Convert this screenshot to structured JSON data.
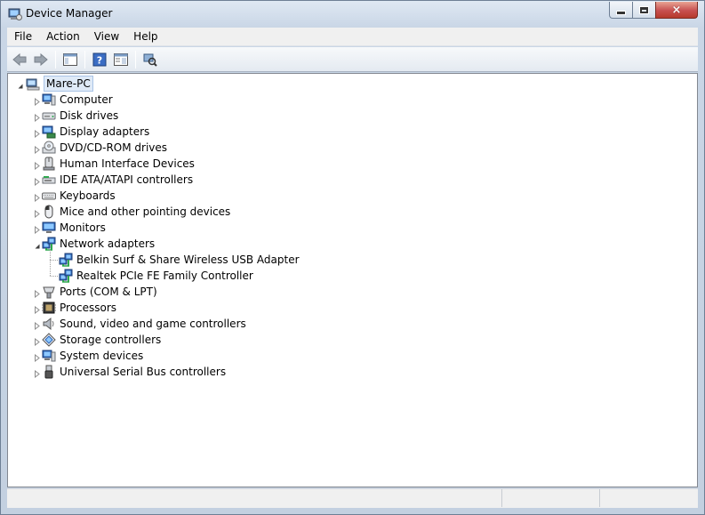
{
  "window": {
    "title": "Device Manager",
    "icon": "device-manager-icon",
    "controls": {
      "minimize": "minimize-icon",
      "maximize": "maximize-icon",
      "close": "×"
    }
  },
  "menu": [
    {
      "label": "File"
    },
    {
      "label": "Action"
    },
    {
      "label": "View"
    },
    {
      "label": "Help"
    }
  ],
  "toolbar": {
    "buttons": [
      "back-arrow-icon",
      "forward-arrow-icon",
      "show-hide-console-tree-icon",
      "help-icon",
      "properties-icon",
      "scan-hardware-icon"
    ]
  },
  "tree": {
    "root": {
      "label": "Mare-PC",
      "expanded": true,
      "icon": "computer-tree-root-icon"
    },
    "categories": [
      {
        "label": "Computer",
        "icon": "computer-icon",
        "expanded": false
      },
      {
        "label": "Disk drives",
        "icon": "disk-drive-icon",
        "expanded": false
      },
      {
        "label": "Display adapters",
        "icon": "display-adapter-icon",
        "expanded": false
      },
      {
        "label": "DVD/CD-ROM drives",
        "icon": "dvd-drive-icon",
        "expanded": false
      },
      {
        "label": "Human Interface Devices",
        "icon": "hid-icon",
        "expanded": false
      },
      {
        "label": "IDE ATA/ATAPI controllers",
        "icon": "ide-controller-icon",
        "expanded": false
      },
      {
        "label": "Keyboards",
        "icon": "keyboard-icon",
        "expanded": false
      },
      {
        "label": "Mice and other pointing devices",
        "icon": "mouse-icon",
        "expanded": false
      },
      {
        "label": "Monitors",
        "icon": "monitor-icon",
        "expanded": false
      },
      {
        "label": "Network adapters",
        "icon": "network-adapter-icon",
        "expanded": true,
        "children": [
          {
            "label": "Belkin Surf & Share Wireless USB Adapter",
            "icon": "network-adapter-icon"
          },
          {
            "label": "Realtek PCIe FE Family Controller",
            "icon": "network-adapter-icon"
          }
        ]
      },
      {
        "label": "Ports (COM & LPT)",
        "icon": "port-icon",
        "expanded": false
      },
      {
        "label": "Processors",
        "icon": "processor-icon",
        "expanded": false
      },
      {
        "label": "Sound, video and game controllers",
        "icon": "speaker-icon",
        "expanded": false
      },
      {
        "label": "Storage controllers",
        "icon": "storage-controller-icon",
        "expanded": false
      },
      {
        "label": "System devices",
        "icon": "system-device-icon",
        "expanded": false
      },
      {
        "label": "Universal Serial Bus controllers",
        "icon": "usb-icon",
        "expanded": false
      }
    ]
  },
  "colors": {
    "selection": "#dfeaf7",
    "window_frame": "#c3d0e0",
    "close_button": "#c75050"
  }
}
